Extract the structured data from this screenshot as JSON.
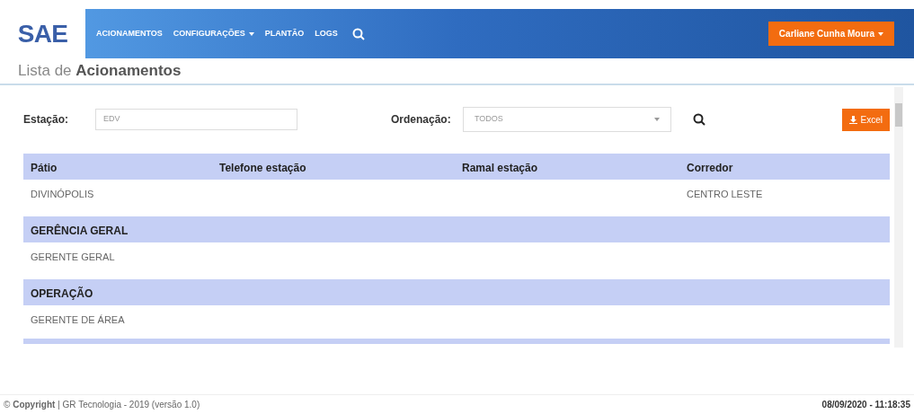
{
  "logo": {
    "text": "SAE"
  },
  "nav": {
    "items": [
      {
        "label": "ACIONAMENTOS",
        "dropdown": false
      },
      {
        "label": "CONFIGURAÇÕES",
        "dropdown": true
      },
      {
        "label": "PLANTÃO",
        "dropdown": false
      },
      {
        "label": "LOGS",
        "dropdown": false
      }
    ],
    "user": "Carliane Cunha Moura"
  },
  "page_title": {
    "prefix": "Lista de",
    "bold": "Acionamentos"
  },
  "filters": {
    "station_label": "Estação:",
    "station_value": "EDV",
    "order_label": "Ordenação:",
    "order_value": "TODOS",
    "export_button": "Excel"
  },
  "table": {
    "rows": [
      {
        "kind": "header",
        "cells": [
          "Pátio",
          "Telefone estação",
          "Ramal estação",
          "Corredor"
        ]
      },
      {
        "kind": "data",
        "cells": [
          "DIVINÓPOLIS",
          "",
          "",
          "CENTRO LESTE"
        ]
      },
      {
        "kind": "header",
        "cells": [
          "GERÊNCIA GERAL"
        ]
      },
      {
        "kind": "data",
        "cells": [
          "GERENTE GERAL"
        ]
      },
      {
        "kind": "header",
        "cells": [
          "OPERAÇÃO"
        ]
      },
      {
        "kind": "data",
        "cells": [
          "GERENTE DE ÁREA"
        ]
      }
    ]
  },
  "footer": {
    "copyright": "© **Copyright** | GR Tecnologia - 2019 (versão 1.0)",
    "datetime": "08/09/2020 - 11:18:35"
  }
}
